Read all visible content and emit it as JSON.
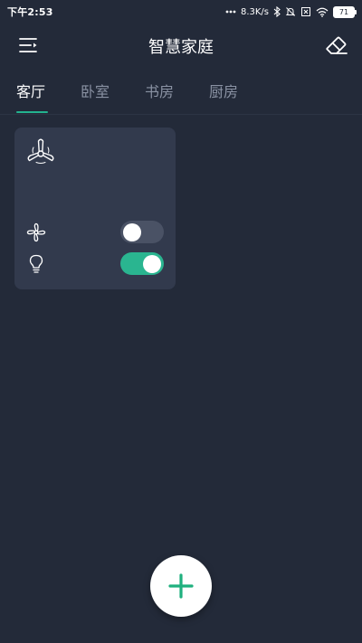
{
  "status_bar": {
    "time": "下午2:53",
    "net_speed": "8.3K/s",
    "battery": "71"
  },
  "app_bar": {
    "title": "智慧家庭",
    "menu_icon": "menu-icon",
    "eraser_icon": "eraser-icon"
  },
  "tabs": [
    {
      "label": "客厅",
      "active": true
    },
    {
      "label": "卧室",
      "active": false
    },
    {
      "label": "书房",
      "active": false
    },
    {
      "label": "厨房",
      "active": false
    }
  ],
  "device_card": {
    "icon": "propeller-icon",
    "devices": [
      {
        "icon": "fan-icon",
        "on": false
      },
      {
        "icon": "lightbulb-icon",
        "on": true
      }
    ]
  },
  "fab": {
    "icon": "plus-icon"
  },
  "colors": {
    "background": "#232a39",
    "card": "#323a4d",
    "accent": "#23b38f",
    "toggle_off": "#4a5265",
    "tab_inactive": "#8a92a3"
  }
}
